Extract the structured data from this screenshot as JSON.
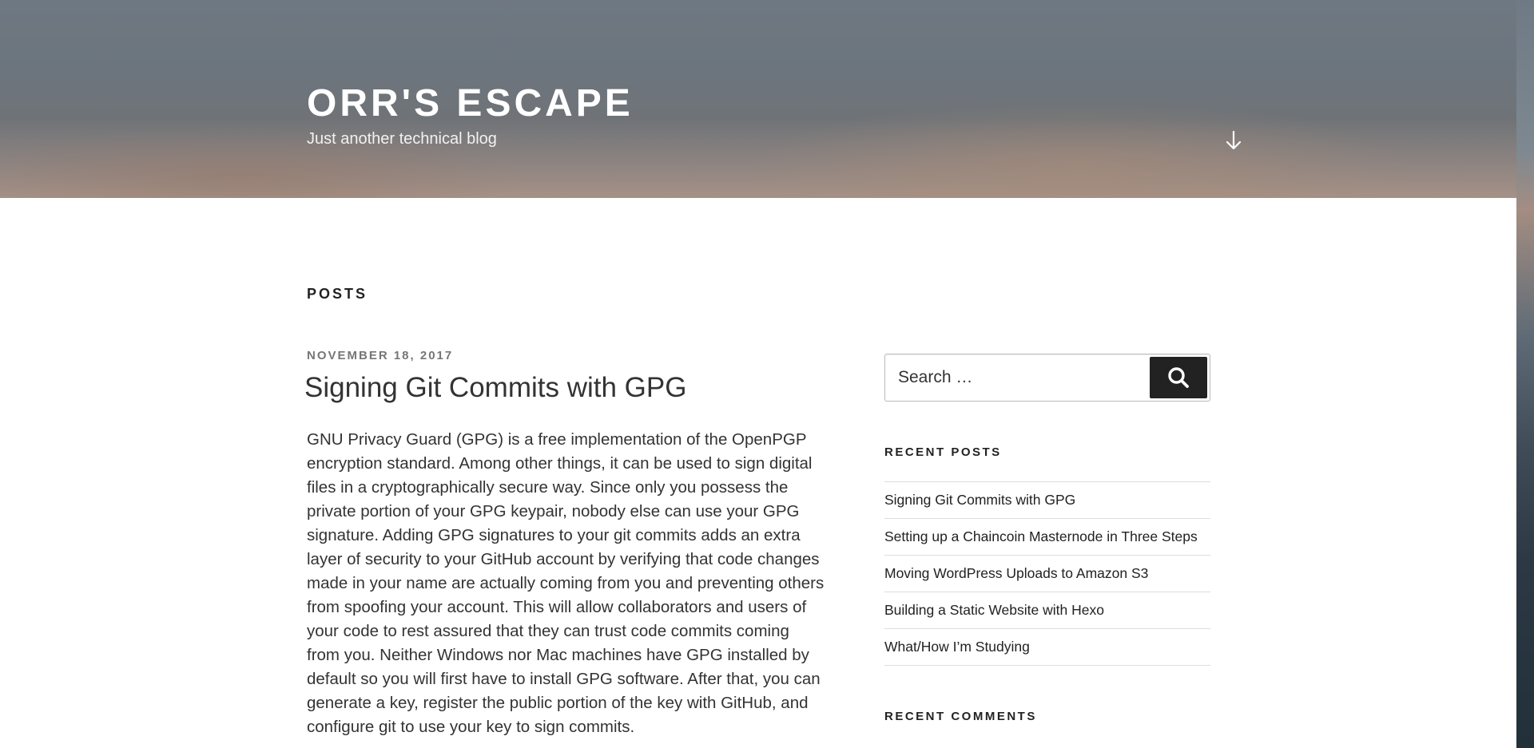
{
  "site": {
    "title": "ORR'S ESCAPE",
    "description": "Just another technical blog"
  },
  "page": {
    "title": "POSTS"
  },
  "post": {
    "date": "NOVEMBER 18, 2017",
    "title": "Signing Git Commits with GPG",
    "body": "GNU Privacy Guard (GPG) is a free implementation of the OpenPGP encryption standard. Among other things, it can be used to sign digital files in a cryptographically secure way. Since only you possess the private portion of your GPG keypair, nobody else can use your GPG signature. Adding GPG signatures to your git commits adds an extra layer of security to your GitHub account by verifying that code changes made in your name are actually coming from you and preventing others from spoofing your account. This will allow collaborators and users of your code to rest assured that they can trust code commits coming from you. Neither Windows nor Mac machines have GPG installed by default so you will first have to install GPG software. After that, you can generate a key, register the public portion of the key with GitHub, and configure git to use your key to sign commits."
  },
  "sidebar": {
    "search": {
      "placeholder": "Search …",
      "button_icon": "search-icon"
    },
    "recent_posts": {
      "title": "RECENT POSTS",
      "items": [
        "Signing Git Commits with GPG",
        "Setting up a Chaincoin Masternode in Three Steps",
        "Moving WordPress Uploads to Amazon S3",
        "Building a Static Website with Hexo",
        "What/How I’m Studying"
      ]
    },
    "recent_comments": {
      "title": "RECENT COMMENTS"
    }
  },
  "icons": {
    "scroll": "arrow-down-icon"
  },
  "colors": {
    "text": "#333333",
    "button_bg": "#222222",
    "meta": "#767676"
  }
}
